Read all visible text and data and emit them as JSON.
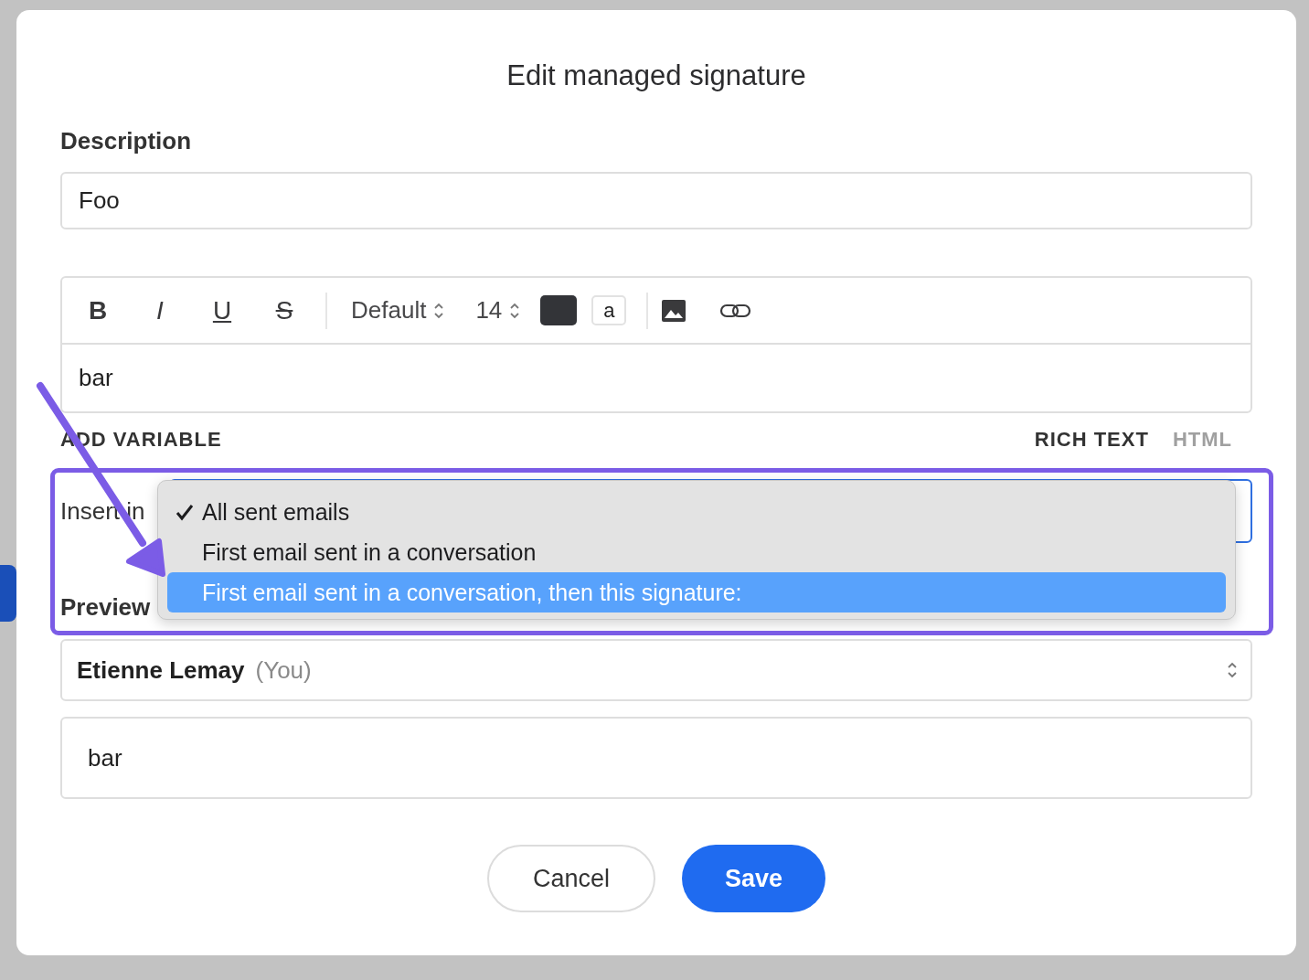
{
  "dialog": {
    "title": "Edit managed signature"
  },
  "description": {
    "label": "Description",
    "value": "Foo"
  },
  "editor": {
    "format_buttons": [
      {
        "kind": "bold",
        "label": "B"
      },
      {
        "kind": "italic",
        "label": "I"
      },
      {
        "kind": "underline",
        "label": "U"
      },
      {
        "kind": "strike",
        "label": "S"
      }
    ],
    "font": "Default",
    "size": "14",
    "highlight": "a",
    "body": "bar"
  },
  "variable_link": "ADD VARIABLE",
  "mode_tabs": [
    {
      "label": "RICH TEXT",
      "selected": true
    },
    {
      "label": "HTML",
      "selected": false
    }
  ],
  "insert_in": {
    "label": "Insert in",
    "options": [
      {
        "label": "All sent emails",
        "checked": true,
        "selected": false
      },
      {
        "label": "First email sent in a conversation",
        "checked": false,
        "selected": false
      },
      {
        "label": "First email sent in a conversation, then this signature:",
        "checked": false,
        "selected": true
      }
    ]
  },
  "preview": {
    "label": "Preview",
    "user_name": "Etienne Lemay",
    "user_note": "(You)",
    "body": "bar"
  },
  "buttons": [
    {
      "label": "Cancel",
      "kind": "secondary"
    },
    {
      "label": "Save",
      "kind": "primary"
    }
  ]
}
